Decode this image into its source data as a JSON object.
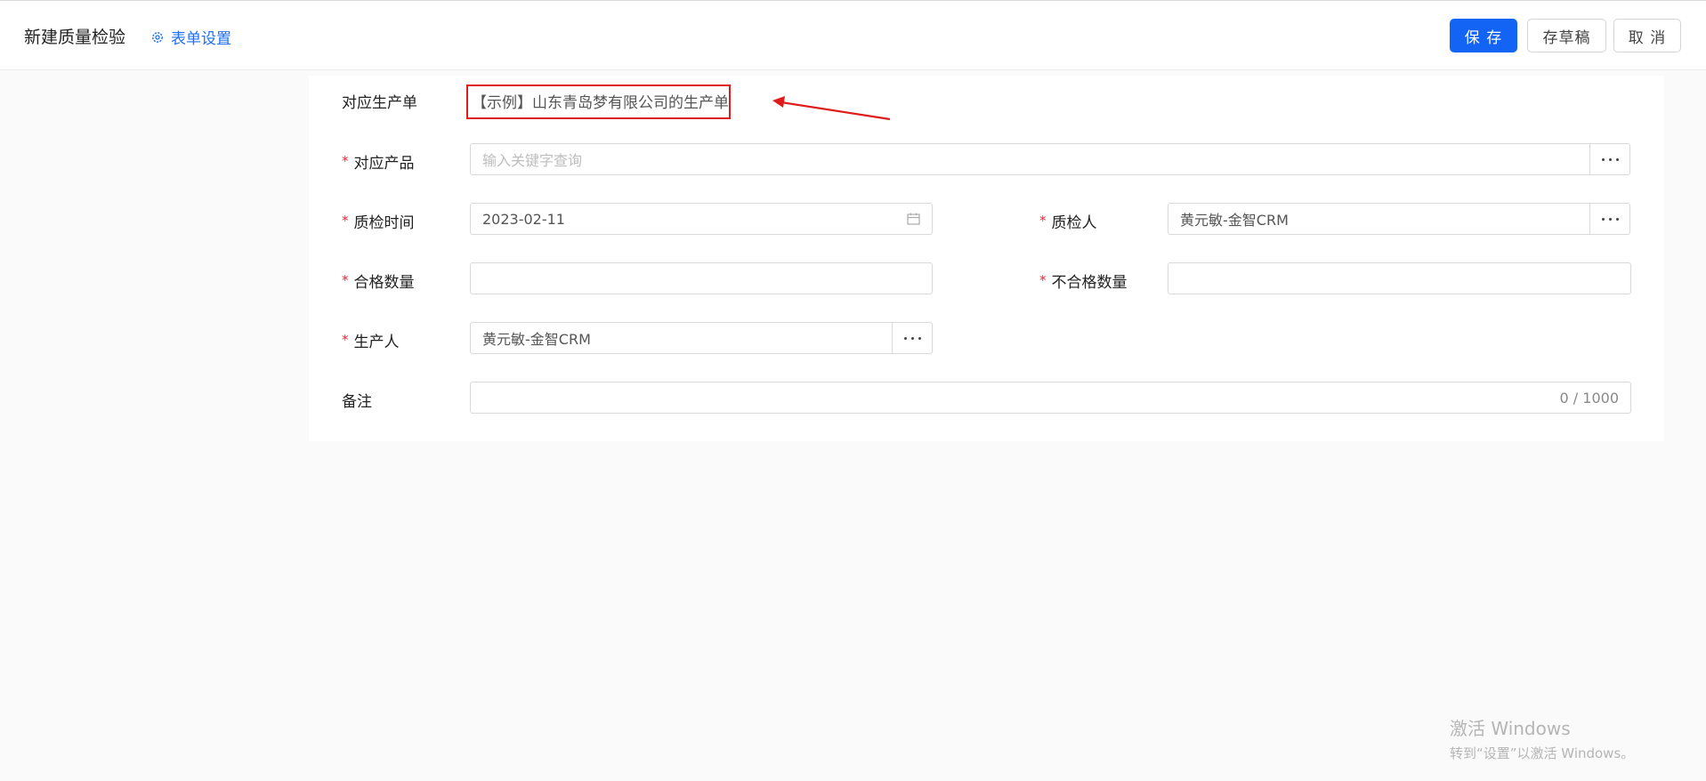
{
  "header": {
    "title": "新建质量检验",
    "form_settings_label": "表单设置",
    "save_label": "保 存",
    "draft_label": "存草稿",
    "cancel_label": "取 消"
  },
  "form": {
    "production_order": {
      "label": "对应生产单",
      "value": "【示例】山东青岛梦有限公司的生产单"
    },
    "product": {
      "label": "对应产品",
      "required": true,
      "placeholder": "输入关键字查询",
      "value": ""
    },
    "inspection_time": {
      "label": "质检时间",
      "required": true,
      "value": "2023-02-11"
    },
    "inspector": {
      "label": "质检人",
      "required": true,
      "value": "黄元敏-金智CRM"
    },
    "qualified_qty": {
      "label": "合格数量",
      "required": true,
      "value": ""
    },
    "unqualified_qty": {
      "label": "不合格数量",
      "required": true,
      "value": ""
    },
    "producer": {
      "label": "生产人",
      "required": true,
      "value": "黄元敏-金智CRM"
    },
    "remarks": {
      "label": "备注",
      "value": "",
      "counter": "0 / 1000"
    }
  },
  "annotation": {
    "highlight_color": "#e01b1b"
  },
  "watermark": {
    "title": "激活 Windows",
    "subtitle": "转到“设置”以激活 Windows。"
  },
  "colors": {
    "primary": "#1364f4",
    "link": "#1d6ff2",
    "required": "#f5222d"
  }
}
